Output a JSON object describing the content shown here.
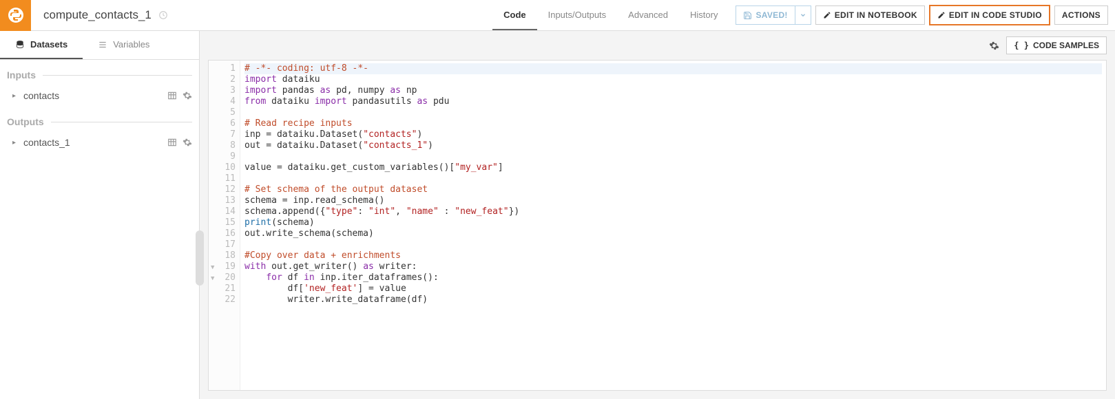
{
  "header": {
    "title": "compute_contacts_1",
    "tabs": [
      "Code",
      "Inputs/Outputs",
      "Advanced",
      "History"
    ],
    "active_tab": "Code",
    "saved_label": "SAVED!",
    "edit_notebook": "EDIT IN NOTEBOOK",
    "edit_code_studio": "EDIT IN CODE STUDIO",
    "actions": "ACTIONS"
  },
  "sidebar": {
    "tabs": {
      "datasets": "Datasets",
      "variables": "Variables"
    },
    "inputs_label": "Inputs",
    "outputs_label": "Outputs",
    "inputs": [
      {
        "name": "contacts"
      }
    ],
    "outputs": [
      {
        "name": "contacts_1"
      }
    ]
  },
  "content_toolbar": {
    "code_samples": "CODE SAMPLES"
  },
  "code": {
    "lines": [
      {
        "n": 1,
        "hl": true,
        "tokens": [
          {
            "t": "# -*- coding: utf-8 -*-",
            "c": "c-comment"
          }
        ]
      },
      {
        "n": 2,
        "tokens": [
          {
            "t": "import",
            "c": "c-keyword"
          },
          {
            "t": " dataiku"
          }
        ]
      },
      {
        "n": 3,
        "tokens": [
          {
            "t": "import",
            "c": "c-keyword"
          },
          {
            "t": " pandas "
          },
          {
            "t": "as",
            "c": "c-keyword"
          },
          {
            "t": " pd, numpy "
          },
          {
            "t": "as",
            "c": "c-keyword"
          },
          {
            "t": " np"
          }
        ]
      },
      {
        "n": 4,
        "tokens": [
          {
            "t": "from",
            "c": "c-keyword"
          },
          {
            "t": " dataiku "
          },
          {
            "t": "import",
            "c": "c-keyword"
          },
          {
            "t": " pandasutils "
          },
          {
            "t": "as",
            "c": "c-keyword"
          },
          {
            "t": " pdu"
          }
        ]
      },
      {
        "n": 5,
        "tokens": []
      },
      {
        "n": 6,
        "tokens": [
          {
            "t": "# Read recipe inputs",
            "c": "c-comment"
          }
        ]
      },
      {
        "n": 7,
        "tokens": [
          {
            "t": "inp = dataiku.Dataset("
          },
          {
            "t": "\"contacts\"",
            "c": "c-str"
          },
          {
            "t": ")"
          }
        ]
      },
      {
        "n": 8,
        "tokens": [
          {
            "t": "out = dataiku.Dataset("
          },
          {
            "t": "\"contacts_1\"",
            "c": "c-str"
          },
          {
            "t": ")"
          }
        ]
      },
      {
        "n": 9,
        "tokens": []
      },
      {
        "n": 10,
        "tokens": [
          {
            "t": "value = dataiku.get_custom_variables()["
          },
          {
            "t": "\"my_var\"",
            "c": "c-str"
          },
          {
            "t": "]"
          }
        ]
      },
      {
        "n": 11,
        "tokens": []
      },
      {
        "n": 12,
        "tokens": [
          {
            "t": "# Set schema of the output dataset",
            "c": "c-comment"
          }
        ]
      },
      {
        "n": 13,
        "tokens": [
          {
            "t": "schema = inp.read_schema()"
          }
        ]
      },
      {
        "n": 14,
        "tokens": [
          {
            "t": "schema.append({"
          },
          {
            "t": "\"type\"",
            "c": "c-str"
          },
          {
            "t": ": "
          },
          {
            "t": "\"int\"",
            "c": "c-str"
          },
          {
            "t": ", "
          },
          {
            "t": "\"name\"",
            "c": "c-str"
          },
          {
            "t": " : "
          },
          {
            "t": "\"new_feat\"",
            "c": "c-str"
          },
          {
            "t": "})"
          }
        ]
      },
      {
        "n": 15,
        "tokens": [
          {
            "t": "print",
            "c": "c-builtin"
          },
          {
            "t": "(schema)"
          }
        ]
      },
      {
        "n": 16,
        "tokens": [
          {
            "t": "out.write_schema(schema)"
          }
        ]
      },
      {
        "n": 17,
        "tokens": []
      },
      {
        "n": 18,
        "tokens": [
          {
            "t": "#Copy over data + enrichments",
            "c": "c-comment"
          }
        ]
      },
      {
        "n": 19,
        "fold": true,
        "tokens": [
          {
            "t": "with",
            "c": "c-keyword"
          },
          {
            "t": " out.get_writer() "
          },
          {
            "t": "as",
            "c": "c-keyword"
          },
          {
            "t": " writer:"
          }
        ]
      },
      {
        "n": 20,
        "fold": true,
        "tokens": [
          {
            "t": "    "
          },
          {
            "t": "for",
            "c": "c-keyword"
          },
          {
            "t": " df "
          },
          {
            "t": "in",
            "c": "c-keyword"
          },
          {
            "t": " inp.iter_dataframes():"
          }
        ]
      },
      {
        "n": 21,
        "tokens": [
          {
            "t": "        df["
          },
          {
            "t": "'new_feat'",
            "c": "c-str"
          },
          {
            "t": "] = value"
          }
        ]
      },
      {
        "n": 22,
        "tokens": [
          {
            "t": "        writer.write_dataframe(df)"
          }
        ]
      }
    ]
  }
}
